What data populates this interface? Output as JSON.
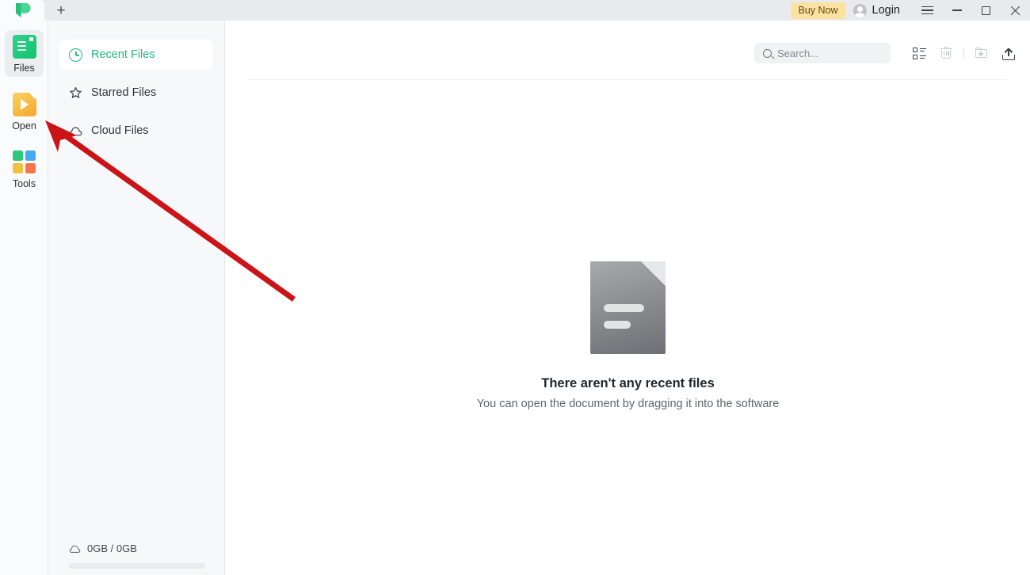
{
  "titlebar": {
    "logo_icon": "app-logo-green-p",
    "new_tab_label": "+",
    "buy_now_label": "Buy Now",
    "login_label": "Login",
    "menu_icon": "hamburger-icon",
    "minimize_icon": "minimize-icon",
    "maximize_icon": "maximize-icon",
    "close_icon": "close-icon"
  },
  "rail": {
    "items": [
      {
        "label": "Files",
        "icon": "files-icon",
        "active": true
      },
      {
        "label": "Open",
        "icon": "open-folder-play-icon",
        "active": false
      },
      {
        "label": "Tools",
        "icon": "tools-grid-icon",
        "active": false
      }
    ]
  },
  "nav": {
    "items": [
      {
        "label": "Recent Files",
        "icon": "clock-icon",
        "active": true
      },
      {
        "label": "Starred Files",
        "icon": "star-icon",
        "active": false
      },
      {
        "label": "Cloud Files",
        "icon": "cloud-icon",
        "active": false
      }
    ],
    "storage": {
      "icon": "cloud-icon",
      "label": "0GB / 0GB",
      "used_percent": 0
    }
  },
  "toolbar": {
    "search_placeholder": "Search...",
    "search_value": "",
    "search_icon": "search-icon",
    "list_view_icon": "list-view-icon",
    "trash_icon": "trash-icon",
    "new_folder_icon": "new-folder-icon",
    "upload_icon": "upload-icon"
  },
  "empty_state": {
    "icon": "document-placeholder-icon",
    "title": "There aren't any recent files",
    "subtitle": "You can open the document by dragging it into the software"
  },
  "annotation": {
    "arrow_color": "#cc1418",
    "points_to": "Open"
  },
  "colors": {
    "accent_green": "#24b47e",
    "buy_now_bg": "#fbe2a0",
    "titlebar_bg": "#e8eaed",
    "panel_bg": "#f7f8f9"
  }
}
